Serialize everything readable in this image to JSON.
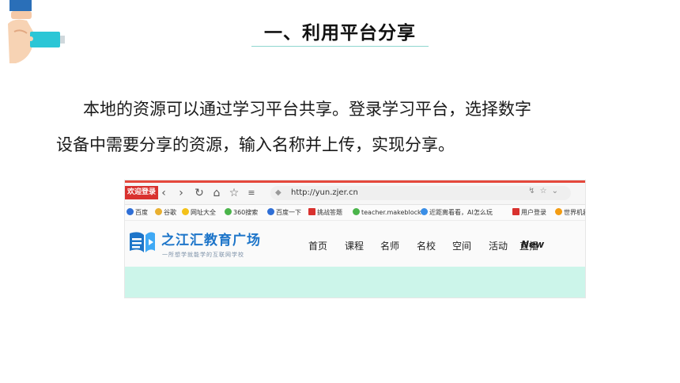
{
  "slide": {
    "title": "一、利用平台分享",
    "body_line1": "本地的资源可以通过学习平台共享。登录学习平台，选择数字",
    "body_line2": "设备中需要分享的资源，输入名称并上传，实现分享。"
  },
  "browser": {
    "site_badge": "欢迎登录",
    "url": "http://yun.zjer.cn",
    "bookmarks": [
      "百度",
      "谷歌",
      "网址大全",
      "360搜索",
      "百度一下",
      "挑战答题",
      "teacher.makeblock.c",
      "近距离看看，AI怎么玩",
      "用户登录",
      "世界机器"
    ],
    "site": {
      "name": "之江汇教育广场",
      "slogan": "一所想学就能学的互联网学校",
      "nav": [
        "首页",
        "课程",
        "名师",
        "名校",
        "空间",
        "活动",
        "直播"
      ],
      "nav_badge": "New"
    }
  },
  "colors": {
    "accent_teal": "#8fd6cf",
    "browser_accent_red": "#e5483c",
    "site_blue": "#1d75c9",
    "banner_mint": "#ccf5ea"
  },
  "icons": [
    "hand-usb-icon",
    "back-arrow-icon",
    "forward-arrow-icon",
    "refresh-icon",
    "home-icon",
    "bookmark-star-icon",
    "shield-icon",
    "lightning-icon",
    "star-icon",
    "chevron-down-icon",
    "zjer-logo-icon"
  ]
}
